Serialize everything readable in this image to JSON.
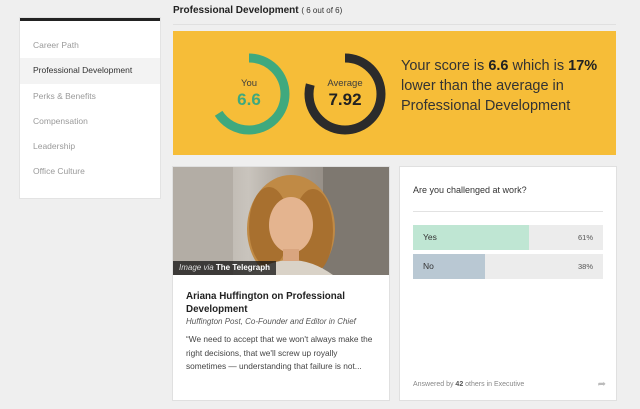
{
  "sidebar": {
    "items": [
      {
        "label": "Career Path"
      },
      {
        "label": "Professional Development",
        "active": true
      },
      {
        "label": "Perks & Benefits"
      },
      {
        "label": "Compensation"
      },
      {
        "label": "Leadership"
      },
      {
        "label": "Office Culture"
      }
    ]
  },
  "header": {
    "title": "Professional Development",
    "count": "( 6 out of 6)"
  },
  "score": {
    "you_label": "You",
    "you_value": "6.6",
    "avg_label": "Average",
    "avg_value": "7.92",
    "text_1": "Your score is ",
    "text_score": "6.6",
    "text_2": " which is ",
    "text_pct": "17%",
    "text_3": " lower than the average in Professional Development",
    "colors": {
      "card": "#f6bd38",
      "you": "#3fa97e",
      "average": "#222222"
    }
  },
  "article": {
    "caption_via": "Image via ",
    "caption_source": "The Telegraph",
    "title": "Ariana Huffington on Professional Development",
    "subtitle": "Huffington Post, Co-Founder and Editor in Chief",
    "quote": "“We need to accept that we won't always make the right decisions, that we'll screw up royally sometimes — understanding that failure is not..."
  },
  "poll": {
    "question": "Are you challenged at work?",
    "options": [
      {
        "label": "Yes",
        "percent_text": "61%",
        "percent": 61
      },
      {
        "label": "No",
        "percent_text": "38%",
        "percent": 38
      }
    ],
    "answered_prefix": "Answered by ",
    "answered_count": "42",
    "answered_suffix": " others in Executive"
  }
}
